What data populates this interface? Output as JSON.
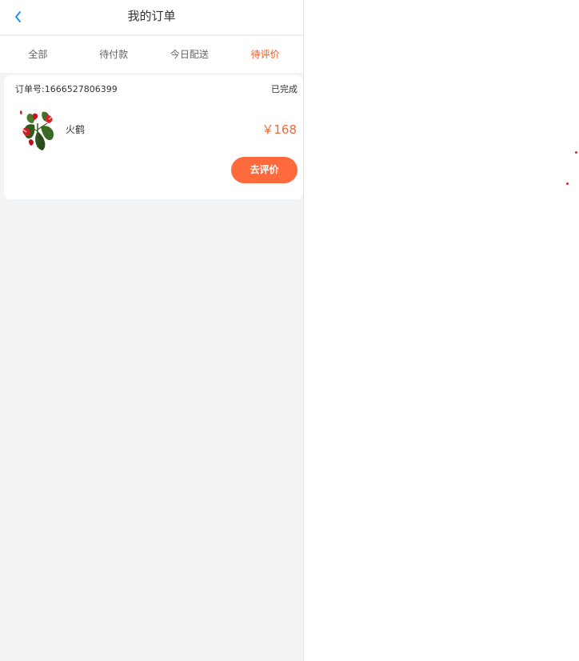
{
  "header": {
    "title": "我的订单",
    "back_icon": "chevron-left-icon",
    "accent_color": "#1989fa"
  },
  "tabs": [
    {
      "label": "全部"
    },
    {
      "label": "待付款"
    },
    {
      "label": "今日配送"
    },
    {
      "label": "待评价",
      "active": true
    }
  ],
  "order": {
    "order_no": "订单号:1666527806399",
    "status": "已完成",
    "product": {
      "name": "火鹤",
      "image_icon": "anthurium-plant-image"
    },
    "price": "￥168",
    "action_label": "去评价"
  },
  "colors": {
    "active_tab": "#ee5a24",
    "price": "#ee6a3a",
    "button": "#ff6a3d",
    "page_bg": "#f2f3f5"
  }
}
